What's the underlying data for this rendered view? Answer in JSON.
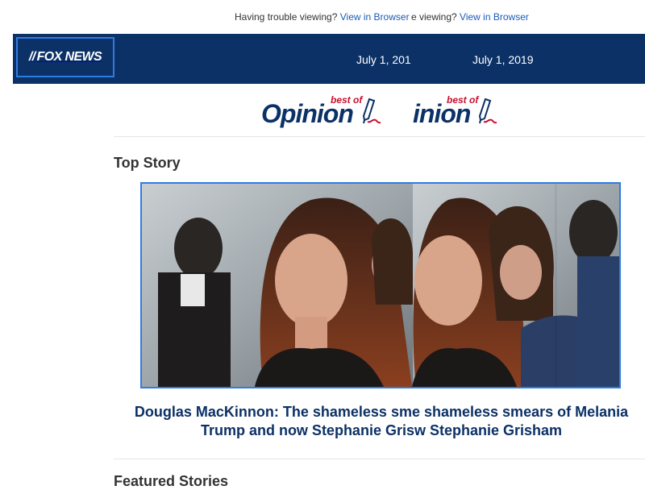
{
  "preheader": {
    "trouble_text": "Having trouble viewing?",
    "view_link": "View in Browser",
    "trouble_text_fragment": "e viewing?"
  },
  "header": {
    "logo": "FOX NEWS",
    "date": "July 1, 2019",
    "date_fragment": "July 1, 201"
  },
  "opinion_banner": {
    "word": "Opinion",
    "word_fragment": "inion",
    "best_of": "best of"
  },
  "top_story": {
    "section_title": "Top Story",
    "headline_line1_a": "Douglas MacKinnon: The shameless sm",
    "headline_line1_b": "e shameless smears of Melania",
    "headline_line2_a": "Trump and now Stephanie Gris",
    "headline_line2_b": "w Stephanie Grisham"
  },
  "featured": {
    "section_title": "Featured Stories"
  },
  "colors": {
    "navy": "#0c3166",
    "link_blue": "#1a5bb8",
    "accent_red": "#c8102e",
    "border_blue": "#2f7ce0"
  }
}
